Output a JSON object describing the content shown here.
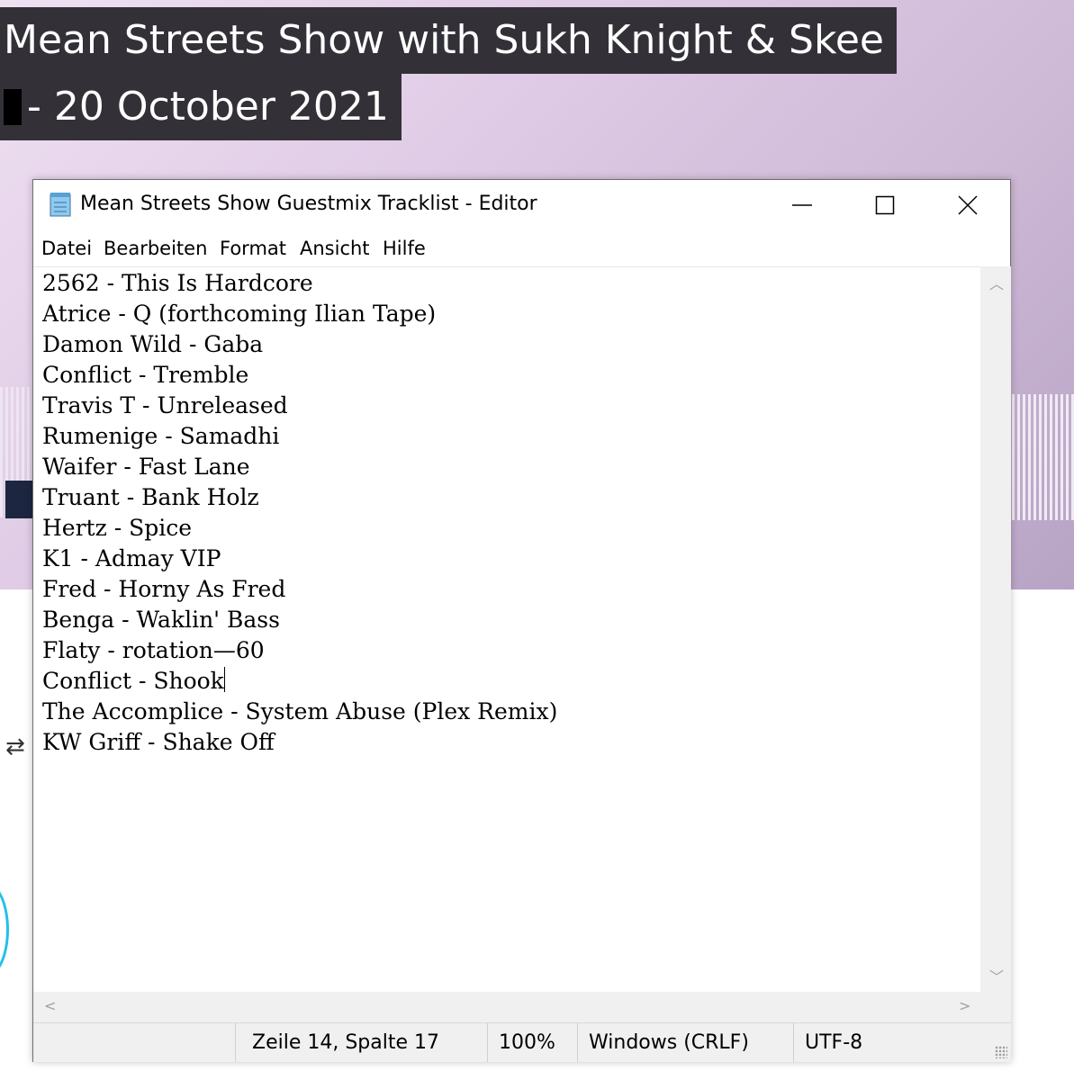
{
  "background": {
    "title_line1": "Mean Streets Show with Sukh Knight & Skee",
    "title_line2": "- 20 October 2021",
    "hero_colors": [
      "#efe0f2",
      "#cdb8d6"
    ],
    "title_bg_color": "#333137",
    "repost_icon": "repost-icon"
  },
  "window": {
    "title": "Mean Streets Show Guestmix Tracklist - Editor",
    "app_icon": "notepad-icon",
    "controls": {
      "minimize": "minimize-icon",
      "maximize": "maximize-icon",
      "close": "close-icon"
    }
  },
  "menu": [
    "Datei",
    "Bearbeiten",
    "Format",
    "Ansicht",
    "Hilfe"
  ],
  "editor": {
    "lines": [
      "2562 - This Is Hardcore",
      "Atrice - Q (forthcoming Ilian Tape)",
      "Damon Wild - Gaba",
      "Conflict - Tremble",
      "Travis T - Unreleased",
      "Rumenige - Samadhi",
      "Waifer - Fast Lane",
      "Truant - Bank Holz",
      "Hertz - Spice",
      "K1 - Admay VIP",
      "Fred - Horny As Fred",
      "Benga - Waklin' Bass",
      "Flaty - rotation—60",
      "Conflict - Shook",
      "The Accomplice - System Abuse (Plex Remix)",
      "KW Griff - Shake Off"
    ],
    "caret_line": 14,
    "caret_column": 17
  },
  "status": {
    "position": "Zeile 14, Spalte 17",
    "zoom": "100%",
    "line_endings": "Windows (CRLF)",
    "encoding": "UTF-8"
  }
}
